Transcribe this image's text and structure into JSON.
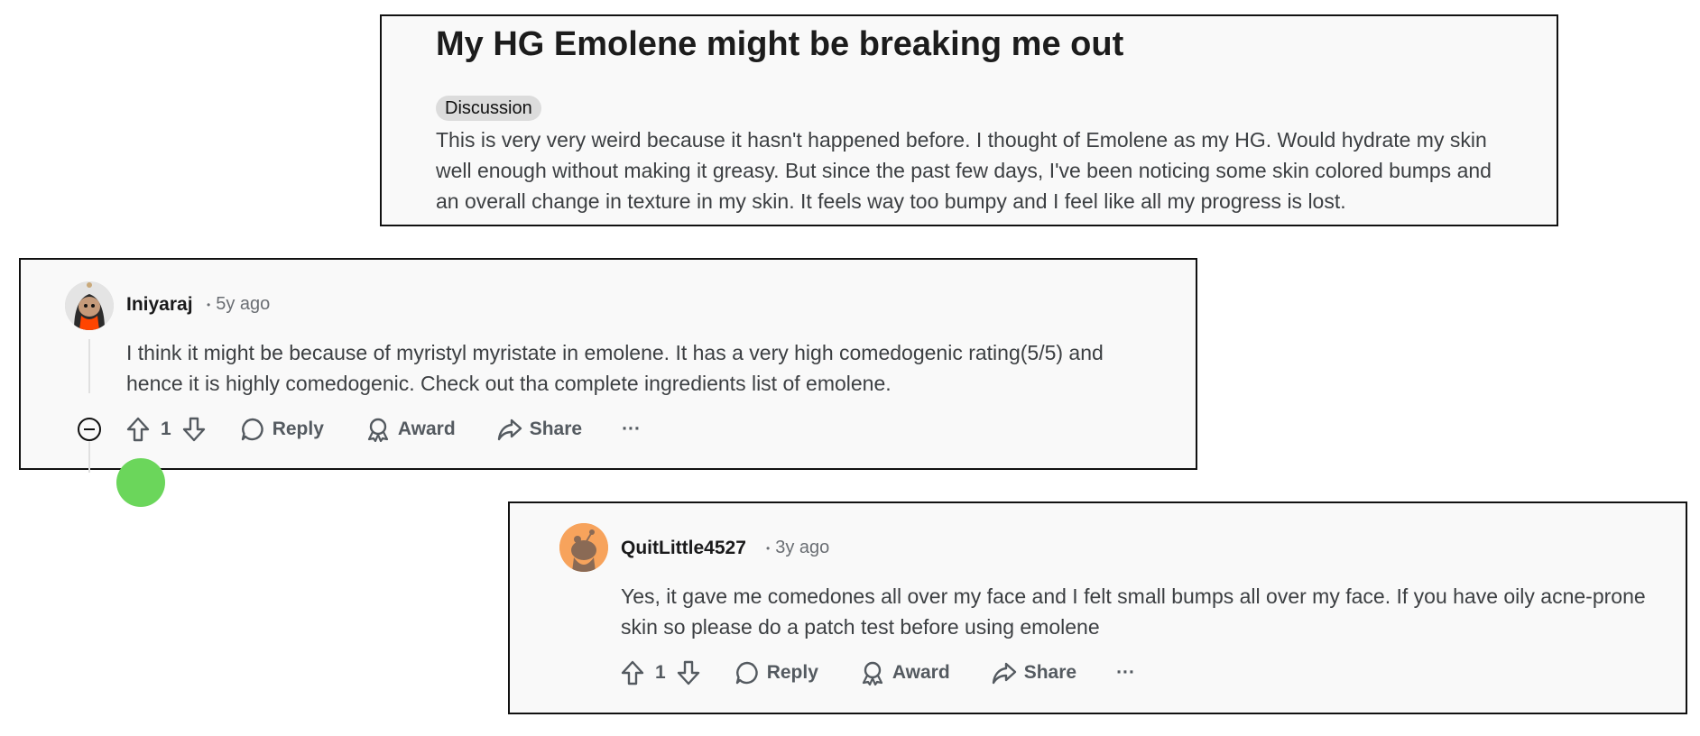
{
  "post": {
    "title": "My HG Emolene might be breaking me out",
    "flair": "Discussion",
    "body": "This is very very weird because it hasn't happened before. I thought of Emolene as my HG. Would hydrate my skin well enough without making it greasy. But since the past few days, I've been noticing some skin colored bumps and an overall change in texture in my skin. It feels way too bumpy and I feel like all my progress is lost."
  },
  "comments": [
    {
      "username": "Iniyaraj",
      "time": "5y ago",
      "body": "I think it might be because of myristyl myristate in emolene. It has a very high comedogenic rating(5/5) and hence it is highly comedogenic. Check out tha complete ingredients list of emolene.",
      "votes": "1",
      "reply_label": "Reply",
      "award_label": "Award",
      "share_label": "Share",
      "more_label": "···",
      "avatar_color": "#d9d9d9"
    },
    {
      "username": "QuitLittle4527",
      "time": "3y ago",
      "body": "Yes, it gave me comedones all over my face and I felt small bumps all over my face. If you have oily acne-prone skin so please do a patch test before using emolene",
      "votes": "1",
      "reply_label": "Reply",
      "award_label": "Award",
      "share_label": "Share",
      "more_label": "···",
      "avatar_color": "#f7a35c"
    }
  ],
  "icons": [
    "upvote-icon",
    "downvote-icon",
    "comment-icon",
    "award-icon",
    "share-icon",
    "more-icon",
    "collapse-icon"
  ],
  "colors": {
    "card_bg": "#f9f9f9",
    "border": "#111111",
    "meta_text": "#6a6e73",
    "action_text": "#545a60",
    "flair_bg": "#dcdcdc"
  }
}
